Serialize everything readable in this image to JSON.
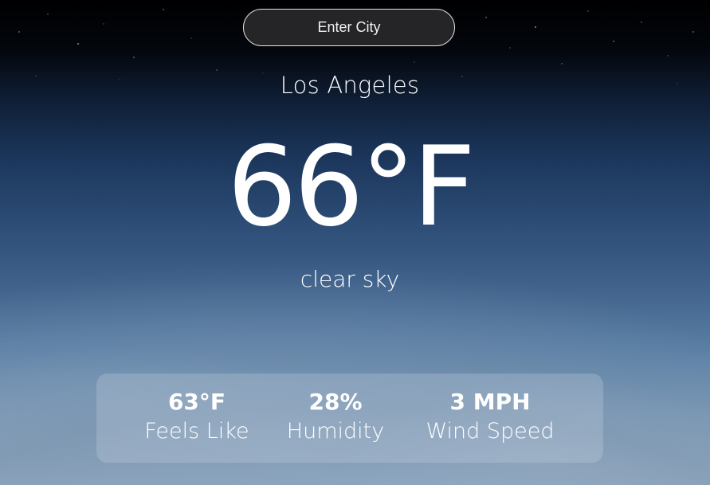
{
  "search": {
    "placeholder": "Enter City"
  },
  "weather": {
    "city": "Los Angeles",
    "temperature": "66°F",
    "description": "clear sky"
  },
  "stats": {
    "feels_like": {
      "value": "63°F",
      "label": "Feels Like"
    },
    "humidity": {
      "value": "28%",
      "label": "Humidity"
    },
    "wind_speed": {
      "value": "3 MPH",
      "label": "Wind Speed"
    }
  }
}
